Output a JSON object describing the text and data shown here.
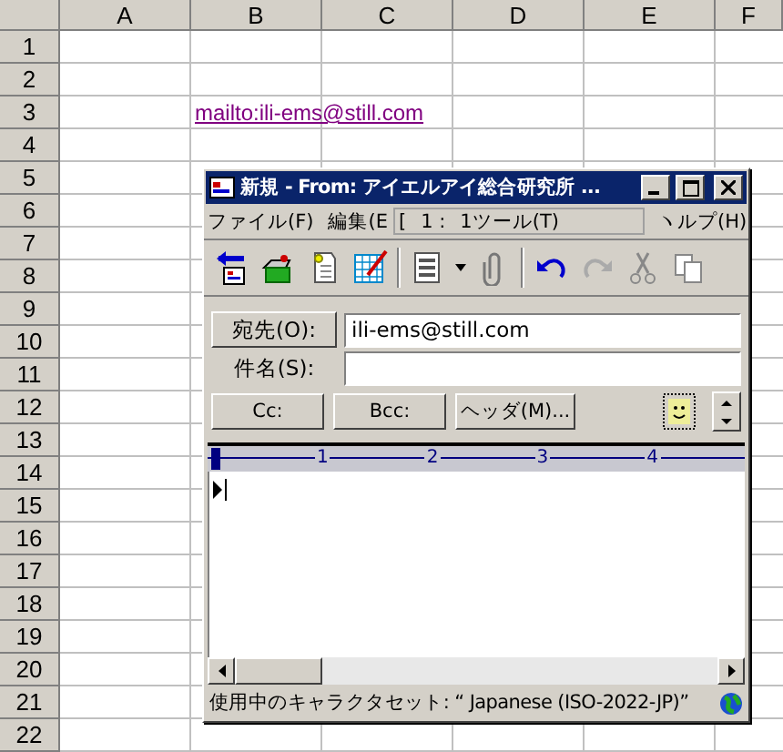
{
  "spreadsheet": {
    "columns": [
      "A",
      "B",
      "C",
      "D",
      "E",
      "F"
    ],
    "rows": [
      {
        "label": "1"
      },
      {
        "label": "2"
      },
      {
        "label": "3",
        "link": "mailto:ili-ems@still.com"
      },
      {
        "label": "4"
      },
      {
        "label": "5"
      },
      {
        "label": "6"
      },
      {
        "label": "7"
      },
      {
        "label": "8"
      },
      {
        "label": "9"
      },
      {
        "label": "10"
      },
      {
        "label": "11"
      },
      {
        "label": "12"
      },
      {
        "label": "13"
      },
      {
        "label": "14"
      },
      {
        "label": "15"
      },
      {
        "label": "16"
      },
      {
        "label": "17"
      },
      {
        "label": "18"
      },
      {
        "label": "19"
      },
      {
        "label": "20"
      },
      {
        "label": "21"
      },
      {
        "label": "22"
      }
    ]
  },
  "window": {
    "title": "新規 - From: アイエルアイ総合研究所 ...",
    "menu": [
      {
        "label": "ファイル(F)"
      },
      {
        "label": "編集(E"
      },
      {
        "label": "ヽルプ(H)"
      }
    ],
    "menu_overlay": [
      "[",
      "1 :",
      "1ツール(T)"
    ],
    "to_button": "宛先(O):",
    "to_value": "ili-ems@still.com",
    "subject_label": "件名(S):",
    "buttons": [
      "Cc:",
      "Bcc:",
      "ヘッダ(M)..."
    ],
    "ruler": [
      "1",
      "2",
      "3",
      "4"
    ],
    "status": "使用中のキャラクタセット: “ Japanese (ISO-2022-JP)”"
  }
}
